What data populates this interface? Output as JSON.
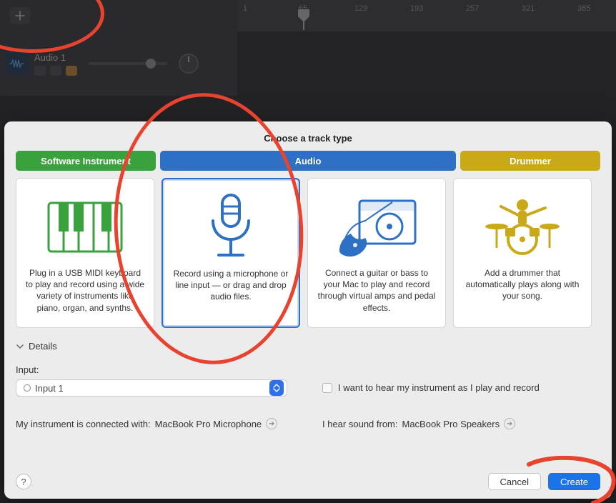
{
  "ruler": {
    "ticks": [
      "1",
      "65",
      "129",
      "193",
      "257",
      "321",
      "385"
    ]
  },
  "track": {
    "name": "Audio 1"
  },
  "sheet": {
    "title": "Choose a track type",
    "tabs": {
      "software": "Software Instrument",
      "audio": "Audio",
      "drummer": "Drummer"
    },
    "cards": {
      "software": "Plug in a USB MIDI keyboard to play and record using a wide variety of instruments like piano, organ, and synths.",
      "mic": "Record using a microphone or line input — or drag and drop audio files.",
      "guitar": "Connect a guitar or bass to your Mac to play and record through virtual amps and pedal effects.",
      "drummer": "Add a drummer that automatically plays along with your song."
    },
    "details_label": "Details",
    "input_label": "Input:",
    "input_value": "Input 1",
    "monitor_checkbox": "I want to hear my instrument as I play and record",
    "input_device_prefix": "My instrument is connected with: ",
    "input_device": "MacBook Pro Microphone",
    "output_device_prefix": "I hear sound from: ",
    "output_device": "MacBook Pro Speakers",
    "help_label": "?",
    "cancel": "Cancel",
    "create": "Create"
  }
}
